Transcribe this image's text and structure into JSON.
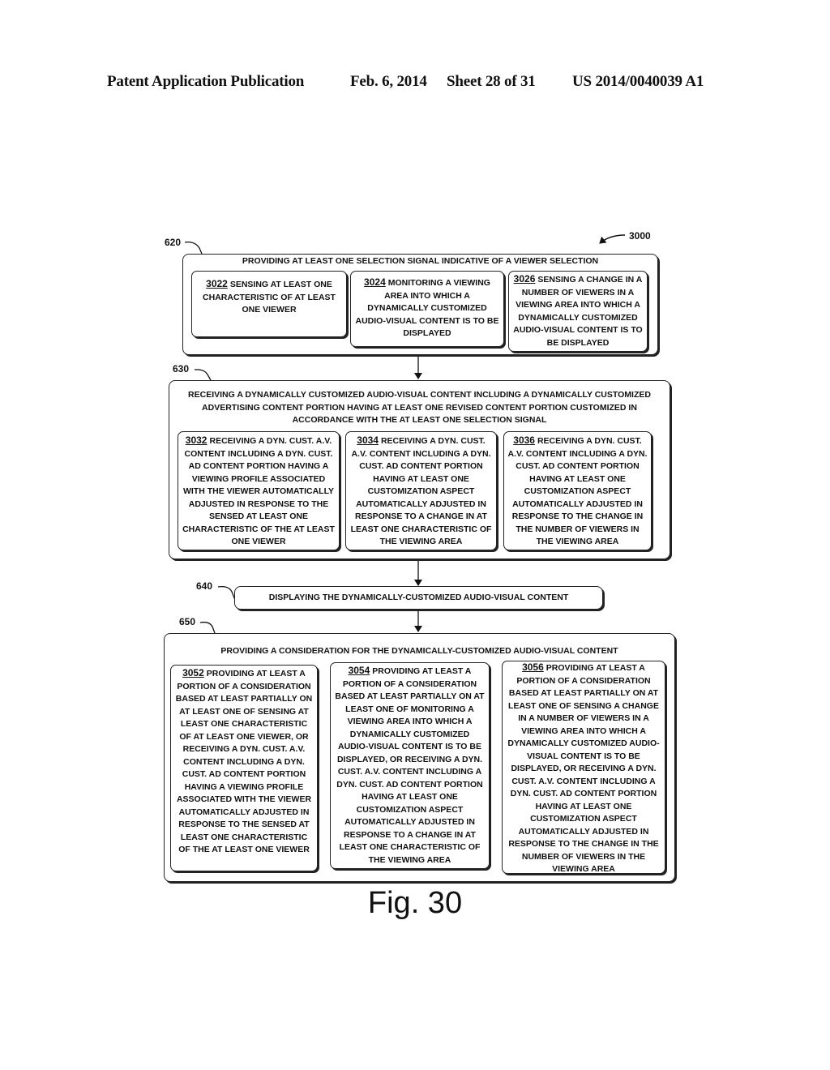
{
  "header": {
    "publication": "Patent Application Publication",
    "date": "Feb. 6, 2014",
    "sheet": "Sheet 28 of 31",
    "patent_number": "US 2014/0040039 A1"
  },
  "figure_ref": "3000",
  "figure_label": "Fig. 30",
  "blocks": {
    "b620": {
      "ref": "620",
      "title": "PROVIDING AT LEAST ONE SELECTION SIGNAL INDICATIVE OF A VIEWER SELECTION",
      "subs": [
        {
          "num": "3022",
          "text": "SENSING AT LEAST ONE CHARACTERISTIC OF AT LEAST ONE VIEWER"
        },
        {
          "num": "3024",
          "text": "MONITORING A VIEWING AREA INTO WHICH A DYNAMICALLY CUSTOMIZED AUDIO-VISUAL CONTENT IS TO BE DISPLAYED"
        },
        {
          "num": "3026",
          "text": "SENSING A CHANGE IN A NUMBER OF VIEWERS IN A VIEWING AREA INTO WHICH A DYNAMICALLY CUSTOMIZED AUDIO-VISUAL CONTENT IS TO BE DISPLAYED"
        }
      ]
    },
    "b630": {
      "ref": "630",
      "title": "RECEIVING A DYNAMICALLY CUSTOMIZED AUDIO-VISUAL CONTENT INCLUDING A DYNAMICALLY CUSTOMIZED ADVERTISING CONTENT PORTION HAVING AT LEAST ONE REVISED CONTENT PORTION CUSTOMIZED IN ACCORDANCE WITH THE AT LEAST ONE SELECTION SIGNAL",
      "subs": [
        {
          "num": "3032",
          "text": "RECEIVING A DYN. CUST. A.V. CONTENT INCLUDING A DYN. CUST. AD CONTENT PORTION HAVING A VIEWING PROFILE ASSOCIATED WITH THE VIEWER AUTOMATICALLY ADJUSTED IN RESPONSE TO THE SENSED AT LEAST ONE CHARACTERISTIC OF THE AT LEAST ONE VIEWER"
        },
        {
          "num": "3034",
          "text": "RECEIVING A DYN. CUST. A.V. CONTENT INCLUDING A DYN. CUST. AD CONTENT PORTION HAVING AT LEAST ONE CUSTOMIZATION ASPECT AUTOMATICALLY ADJUSTED IN RESPONSE TO A CHANGE IN AT LEAST ONE CHARACTERISTIC OF THE VIEWING AREA"
        },
        {
          "num": "3036",
          "text": "RECEIVING A DYN. CUST. A.V. CONTENT INCLUDING A DYN. CUST. AD CONTENT PORTION HAVING AT LEAST ONE CUSTOMIZATION ASPECT AUTOMATICALLY ADJUSTED IN RESPONSE TO THE CHANGE IN THE NUMBER OF VIEWERS IN THE VIEWING AREA"
        }
      ]
    },
    "b640": {
      "ref": "640",
      "title": "DISPLAYING THE DYNAMICALLY-CUSTOMIZED AUDIO-VISUAL CONTENT"
    },
    "b650": {
      "ref": "650",
      "title": "PROVIDING A CONSIDERATION FOR THE DYNAMICALLY-CUSTOMIZED AUDIO-VISUAL CONTENT",
      "subs": [
        {
          "num": "3052",
          "text": "PROVIDING AT LEAST A PORTION OF A CONSIDERATION BASED AT LEAST PARTIALLY ON AT LEAST ONE OF SENSING AT LEAST ONE CHARACTERISTIC OF AT LEAST ONE VIEWER, OR RECEIVING A DYN. CUST. A.V. CONTENT INCLUDING A DYN. CUST. AD CONTENT PORTION HAVING A VIEWING PROFILE ASSOCIATED WITH THE VIEWER AUTOMATICALLY ADJUSTED IN RESPONSE TO THE SENSED AT LEAST ONE CHARACTERISTIC OF THE AT LEAST ONE VIEWER"
        },
        {
          "num": "3054",
          "text": "PROVIDING AT LEAST A PORTION OF A CONSIDERATION BASED AT LEAST PARTIALLY ON AT LEAST ONE OF MONITORING A VIEWING AREA INTO WHICH A DYNAMICALLY CUSTOMIZED AUDIO-VISUAL CONTENT IS TO BE DISPLAYED, OR RECEIVING A DYN. CUST. A.V. CONTENT INCLUDING A DYN. CUST. AD CONTENT PORTION HAVING AT LEAST ONE CUSTOMIZATION ASPECT AUTOMATICALLY ADJUSTED IN RESPONSE TO A CHANGE IN AT LEAST ONE CHARACTERISTIC OF THE VIEWING AREA"
        },
        {
          "num": "3056",
          "text": "PROVIDING AT LEAST A PORTION OF A CONSIDERATION BASED AT LEAST PARTIALLY ON AT LEAST ONE OF SENSING A CHANGE IN A NUMBER OF VIEWERS IN A VIEWING AREA INTO WHICH A DYNAMICALLY CUSTOMIZED AUDIO-VISUAL CONTENT IS TO BE DISPLAYED, OR RECEIVING A DYN. CUST. A.V. CONTENT INCLUDING A DYN. CUST. AD CONTENT PORTION HAVING AT LEAST ONE CUSTOMIZATION ASPECT AUTOMATICALLY ADJUSTED IN RESPONSE TO THE CHANGE IN THE NUMBER OF VIEWERS IN THE VIEWING AREA"
        }
      ]
    }
  }
}
